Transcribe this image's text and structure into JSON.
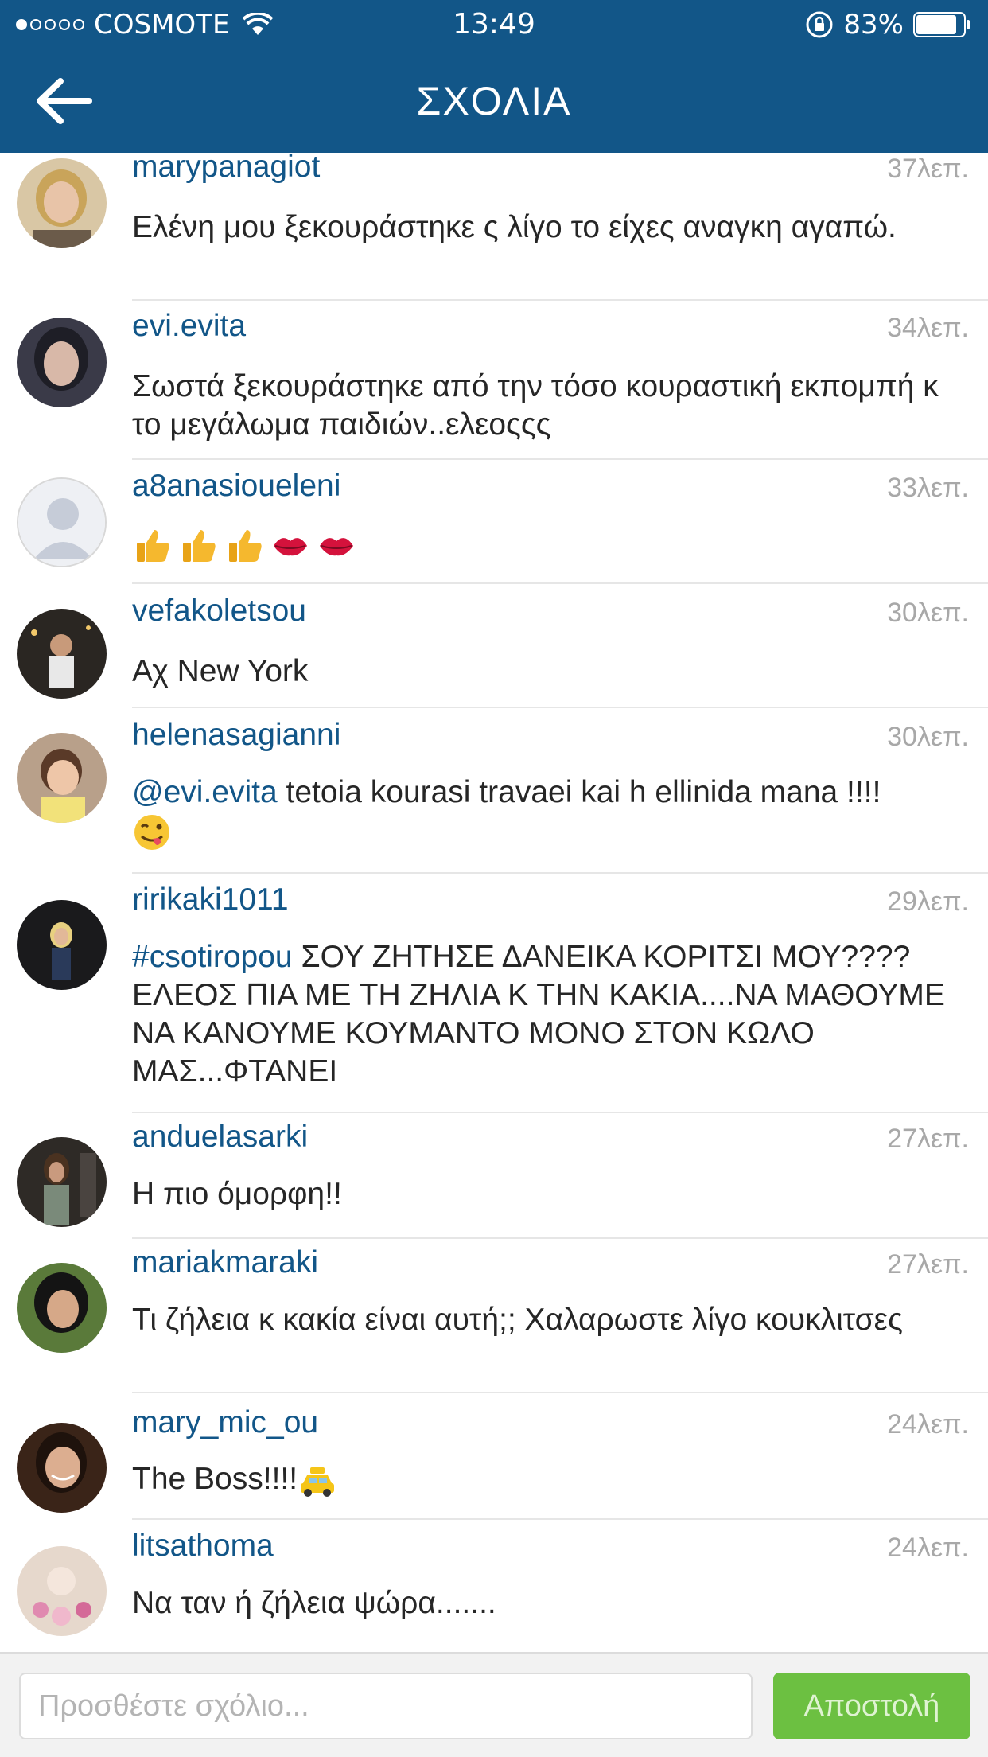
{
  "status_bar": {
    "carrier": "COSMOTE",
    "time": "13:49",
    "battery": "83%"
  },
  "header": {
    "title": "ΣΧΟΛΙΑ"
  },
  "comments": [
    {
      "user": "marypanagiot",
      "time": "37λεπ.",
      "text": "Ελένη μου ξεκουράστηκε ς λίγο το είχες αναγκη αγαπώ."
    },
    {
      "user": "evi.evita",
      "time": "34λεπ.",
      "text": "Σωστά ξεκουράστηκε από την τόσο κουραστική εκπομπή κ το μεγάλωμα παιδιών..ελεοςςς"
    },
    {
      "user": "a8anasioueleni",
      "time": "33λεπ.",
      "emojis": [
        "thumbs-up",
        "thumbs-up",
        "thumbs-up",
        "kiss-lips",
        "kiss-lips"
      ]
    },
    {
      "user": "vefakoletsou",
      "time": "30λεπ.",
      "text": "Αχ New York"
    },
    {
      "user": "helenasagianni",
      "time": "30λεπ.",
      "mention": "@evi.evita",
      "text": " tetoia kourasi travaei kai h ellinida mana !!!!",
      "emoji": "winking-tongue-face"
    },
    {
      "user": "ririkaki1011",
      "time": "29λεπ.",
      "mention": "#csotiropou",
      "text": " ΣΟΥ ΖΗΤΗΣΕ ΔΑΝΕΙΚΑ ΚΟΡΙΤΣΙ ΜΟΥ????ΕΛΕΟΣ ΠΙΑ ΜΕ ΤΗ ΖΗΛΙΑ Κ ΤΗΝ ΚΑΚΙΑ....ΝΑ ΜΑΘΟΥΜΕ ΝΑ ΚΑΝΟΥΜΕ ΚΟΥΜΑΝΤΟ ΜΟΝΟ ΣΤΟΝ ΚΩΛΟ ΜΑΣ...ΦΤΑΝΕΙ"
    },
    {
      "user": "anduelasarki",
      "time": "27λεπ.",
      "text": "Η πιο όμορφη!!"
    },
    {
      "user": "mariakmaraki",
      "time": "27λεπ.",
      "text": "Τι ζήλεια κ κακία είναι αυτή;; Χαλαρωστε λίγο κουκλιτσες"
    },
    {
      "user": "mary_mic_ou",
      "time": "24λεπ.",
      "text": "The Boss!!!!",
      "emoji": "taxi"
    },
    {
      "user": "litsathoma",
      "time": "24λεπ.",
      "text": "Να ταν ή ζήλεια ψώρα......."
    }
  ],
  "composer": {
    "placeholder": "Προσθέστε σχόλιο...",
    "send_label": "Αποστολή"
  },
  "colors": {
    "brand": "#125688",
    "send": "#6cc041",
    "time": "#a8a8a8"
  }
}
